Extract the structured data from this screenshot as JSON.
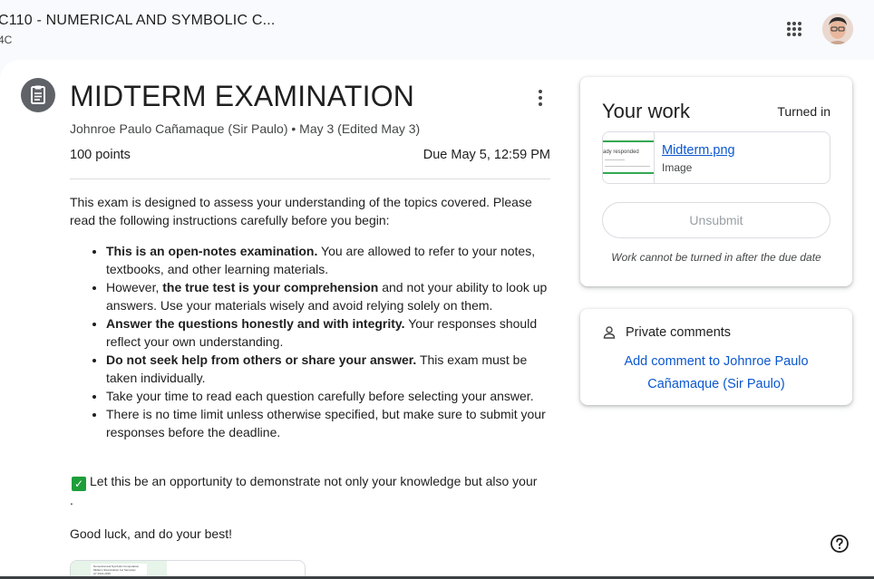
{
  "header": {
    "course_title": "C110 - NUMERICAL AND SYMBOLIC C...",
    "course_section": "4C",
    "apps_icon": "grid-apps-icon",
    "avatar_icon": "user-avatar"
  },
  "assignment": {
    "icon": "assignment-clipboard-icon",
    "title": "MIDTERM EXAMINATION",
    "meta": "Johnroe Paulo Cañamaque (Sir Paulo) • May 3 (Edited May 3)",
    "points": "100 points",
    "due": "Due May 5, 12:59 PM",
    "intro": "This exam is designed to assess your understanding of the topics covered. Please read the following instructions carefully before you begin:",
    "bullets": [
      {
        "bold_before": "",
        "bold": "This is an open-notes examination.",
        "text": " You are allowed to refer to your notes, textbooks, and other learning materials."
      },
      {
        "bold_before": "However, ",
        "bold": "the true test is your comprehension",
        "text": "  and not your ability to look up answers. Use your materials wisely and avoid relying solely on them."
      },
      {
        "bold_before": "",
        "bold": "Answer the questions honestly and with integrity.",
        "text": " Your responses should reflect your own understanding."
      },
      {
        "bold_before": "",
        "bold": "Do not seek help from others or share your answer.",
        "text": " This exam must be taken individually."
      },
      {
        "bold_before": "",
        "bold": "",
        "text": "Take your time to read each question carefully before selecting your answer."
      },
      {
        "bold_before": "",
        "bold": "",
        "text": "There is no time limit unless otherwise specified, but make sure to submit your responses before the deadline."
      }
    ],
    "closing": "Let this be an opportunity to demonstrate not only your knowledge but also your .",
    "closing_icon": "green-checkmark-icon",
    "good_luck": "Good luck, and do your best!",
    "attachment_thumb_lines": [
      "Numerical and Symbolic Computation",
      "Midterm Examination 1st Semester",
      "AY 2024-2025"
    ]
  },
  "your_work": {
    "title": "Your work",
    "status": "Turned in",
    "file_name": "Midterm.png",
    "file_type": "Image",
    "file_thumb_text": "ady responded",
    "unsubmit_label": "Unsubmit",
    "notice": "Work cannot be turned in after the due date"
  },
  "private_comments": {
    "icon": "person-icon",
    "title": "Private comments",
    "add_comment": "Add comment to Johnroe Paulo Cañamaque (Sir Paulo)"
  },
  "help_icon": "help-question-icon",
  "colors": {
    "link_blue": "#0b57d0",
    "check_green": "#1e9e3a",
    "page_background": "#f8fafd"
  }
}
